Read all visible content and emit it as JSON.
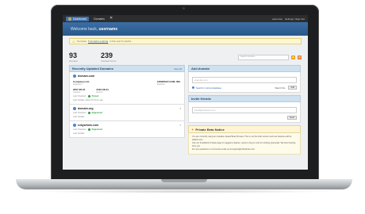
{
  "nav": {
    "dashboard": "Dashboard",
    "domains": "Domains",
    "right_user": "username",
    "right_links": "Settings | Sign Out"
  },
  "header": {
    "welcome": "Welcome back,",
    "user": "username"
  },
  "alert": {
    "prefix": "You have",
    "link": "5 domains expiring",
    "suffix": "in the next 6 months"
  },
  "stats": [
    {
      "num": "93",
      "label": "Domains"
    },
    {
      "num": "239",
      "label": "Checked Terms"
    }
  ],
  "filter_placeholder": "Search domains...",
  "recent": {
    "title": "Recently Updated Domains",
    "view_all": "View All",
    "domains": [
      {
        "name": "domain.com",
        "registrant": "Company.com",
        "registrant_sub": "Registrant",
        "registrar": "COMPANY.COM, INC.",
        "registrar_sub": "Registrar",
        "created": "2007-08-24",
        "created_sub": "Created",
        "expires": "2016-08-24",
        "expires_sub": "Expires",
        "check": "Last Checked:",
        "status": "Parsed",
        "updated": "Last Update: about 20 hours ago"
      },
      {
        "name": "domain.org",
        "check": "Last Checked:",
        "status": "Registered",
        "updated": "Last Update:"
      },
      {
        "name": "rubywhois.com",
        "check": "Last Checked:",
        "status": "Registered",
        "updated": "Last Update:"
      }
    ]
  },
  "add_domain": {
    "title": "Add domain",
    "placeholder": "example.com",
    "search_label": "Search in whois database",
    "watch_label": "Watch this",
    "button": "Add"
  },
  "invite": {
    "title": "Invite friends",
    "placeholder": "friend@example.com",
    "button": "Send"
  },
  "notice": {
    "title": "Private Beta Notice",
    "body1": "You are currently using an invitation-based Beta Preview. This is not the final version and new features will be added soon.",
    "body2": "Use our Feedback & Ideas page to suggest a feature, report a bug or vote for existing proposals. We love hearing from you.",
    "body3": "For any questions or comments email us at support@robowhois.com"
  }
}
